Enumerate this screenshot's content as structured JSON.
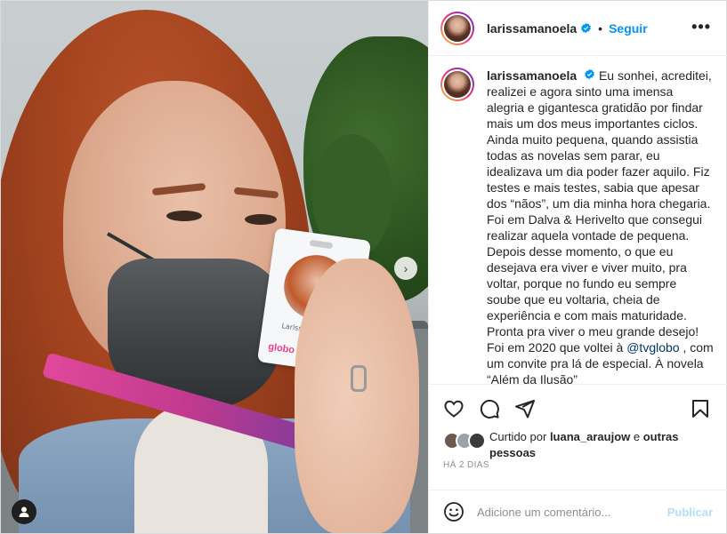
{
  "post": {
    "author": {
      "username": "larissamanoela",
      "verified": true,
      "follow_label": "Seguir",
      "separator": "•",
      "more_label": "•••"
    },
    "media": {
      "badge_name": "Larissa Manoela",
      "badge_logo": "globo"
    },
    "caption": {
      "username": "larissamanoela",
      "text_before_mention": "Eu sonhei, acreditei, realizei e agora sinto uma imensa alegria e gigantesca gratidão por findar mais um dos meus importantes ciclos. Ainda muito pequena, quando assistia todas as novelas sem parar, eu idealizava um dia poder fazer aquilo. Fiz testes e mais testes, sabia que apesar dos “nãos”, um dia minha hora chegaria. Foi em Dalva & Herivelto que consegui realizar aquela vontade de pequena. Depois desse momento, o que eu desejava era viver e viver muito, pra voltar, porque no fundo eu sempre soube que eu voltaria, cheia de experiência e com mais maturidade. Pronta pra viver o meu grande desejo! Foi em 2020 que voltei à ",
      "mention": "@tvglobo",
      "text_after_mention": " , com um convite pra lá de especial. À novela “Além da Ilusão”"
    },
    "likes": {
      "prefix": "Curtido por",
      "user": "luana_araujow",
      "connector": "e",
      "others": "outras pessoas"
    },
    "timestamp": "HÁ 2 DIAS",
    "comment": {
      "placeholder": "Adicione um comentário...",
      "publish_label": "Publicar"
    }
  },
  "colors": {
    "accent": "#0095f6",
    "publish_disabled": "#b2dffc",
    "text": "#262626",
    "muted": "#8e8e8e",
    "mention": "#00376b"
  }
}
